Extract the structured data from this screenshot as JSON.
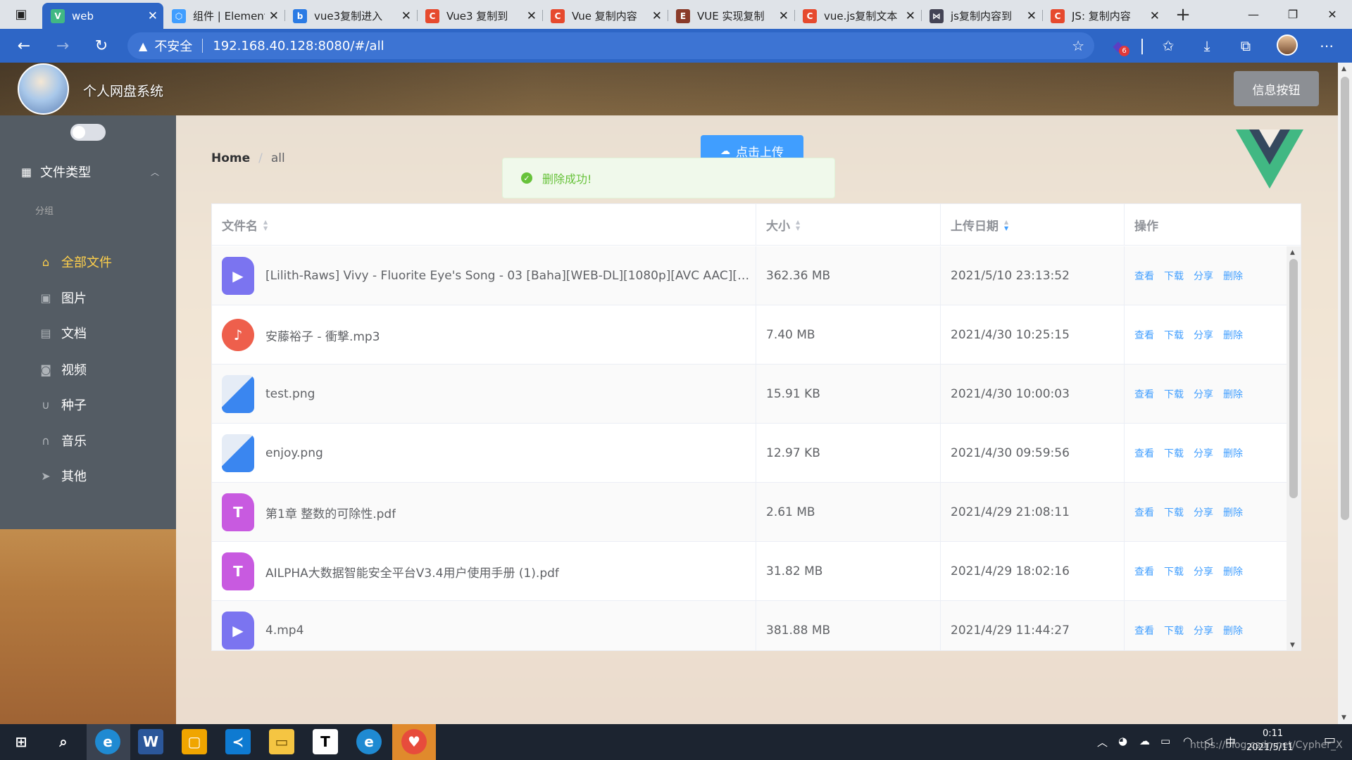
{
  "browser": {
    "tabs": [
      {
        "title": "web",
        "favicon": "vue-icon",
        "fav_color": "#41b883",
        "fav_text": "V",
        "active": true
      },
      {
        "title": "组件 | Element",
        "favicon": "element-icon",
        "fav_color": "#409eff",
        "fav_text": "⬡"
      },
      {
        "title": "vue3复制进入",
        "favicon": "bing-icon",
        "fav_color": "#2b7be4",
        "fav_text": "b"
      },
      {
        "title": "Vue3 复制到",
        "favicon": "csdn-icon",
        "fav_color": "#e64a2e",
        "fav_text": "C"
      },
      {
        "title": "Vue 复制内容",
        "favicon": "csdn-icon",
        "fav_color": "#e64a2e",
        "fav_text": "C"
      },
      {
        "title": "VUE 实现复制",
        "favicon": "doc-icon",
        "fav_color": "#8a3b2a",
        "fav_text": "E"
      },
      {
        "title": "vue.js复制文本",
        "favicon": "csdn-icon",
        "fav_color": "#e64a2e",
        "fav_text": "C"
      },
      {
        "title": "js复制内容到",
        "favicon": "juejin-icon",
        "fav_color": "#445",
        "fav_text": "⋈"
      },
      {
        "title": "JS: 复制内容",
        "favicon": "csdn-icon",
        "fav_color": "#e64a2e",
        "fav_text": "C"
      }
    ],
    "insecure_label": "不安全",
    "url": "192.168.40.128:8080/#/all",
    "extension_badge": "6"
  },
  "header": {
    "site_title": "个人网盘系统",
    "info_button": "信息按钮"
  },
  "sidebar": {
    "submenu_title": "文件类型",
    "group_title": "分组",
    "items": [
      {
        "label": "全部文件",
        "icon": "home-icon",
        "glyph": "⌂",
        "active": true
      },
      {
        "label": "图片",
        "icon": "picture-icon",
        "glyph": "▣"
      },
      {
        "label": "文档",
        "icon": "document-icon",
        "glyph": "▤"
      },
      {
        "label": "视频",
        "icon": "video-camera-icon",
        "glyph": "◙"
      },
      {
        "label": "种子",
        "icon": "magnet-icon",
        "glyph": "∪"
      },
      {
        "label": "音乐",
        "icon": "headset-icon",
        "glyph": "∩"
      },
      {
        "label": "其他",
        "icon": "paper-plane-icon",
        "glyph": "➤"
      }
    ]
  },
  "breadcrumb": {
    "home": "Home",
    "separator": "/",
    "current": "all"
  },
  "upload_button": "点击上传",
  "toast": {
    "message": "删除成功!",
    "type": "success",
    "color": "#67c23a"
  },
  "table": {
    "columns": [
      "文件名",
      "大小",
      "上传日期",
      "操作"
    ],
    "operations": [
      "查看",
      "下载",
      "分享",
      "删除"
    ],
    "rows": [
      {
        "name": "[Lilith-Raws] Vivy - Fluorite Eye's Song - 03 [Baha][WEB-DL][1080p][AVC AAC][CHT][...",
        "type": "video",
        "size": "362.36 MB",
        "date": "2021/5/10 23:13:52"
      },
      {
        "name": "安藤裕子 - 衝撃.mp3",
        "type": "music",
        "size": "7.40 MB",
        "date": "2021/4/30 10:25:15"
      },
      {
        "name": "test.png",
        "type": "image",
        "size": "15.91 KB",
        "date": "2021/4/30 10:00:03"
      },
      {
        "name": "enjoy.png",
        "type": "image",
        "size": "12.97 KB",
        "date": "2021/4/30 09:59:56"
      },
      {
        "name": "第1章 整数的可除性.pdf",
        "type": "pdf",
        "size": "2.61 MB",
        "date": "2021/4/29 21:08:11"
      },
      {
        "name": "AILPHA大数据智能安全平台V3.4用户使用手册 (1).pdf",
        "type": "pdf",
        "size": "31.82 MB",
        "date": "2021/4/29 18:02:16"
      },
      {
        "name": "4.mp4",
        "type": "video",
        "size": "381.88 MB",
        "date": "2021/4/29 11:44:27"
      }
    ]
  },
  "taskbar": {
    "time": "0:11",
    "date": "2021/5/11",
    "watermark": "https://blog.csdn.net/Cypher_X"
  },
  "colors": {
    "accent": "#409eff",
    "menu_active": "#ffd04b",
    "sidebar_bg": "#545c64",
    "browser_blue": "#2e66c6"
  }
}
